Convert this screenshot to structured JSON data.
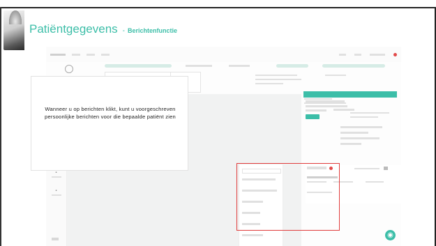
{
  "slide": {
    "title": "Patiëntgegevens",
    "separator": "-",
    "subtitle": "Berichtenfunctie"
  },
  "callout": {
    "text": "Wanneer u op berichten klikt, kunt u voorgeschreven persoonlijke berichten voor die bepaalde patiënt zien"
  },
  "colors": {
    "accent": "#3cbea8",
    "highlight_border": "#e03b3b"
  },
  "icons": {
    "fab": "chat-icon",
    "rail": [
      "home-icon",
      "calendar-icon",
      "people-icon",
      "grid-icon",
      "message-icon",
      "add-icon"
    ]
  }
}
